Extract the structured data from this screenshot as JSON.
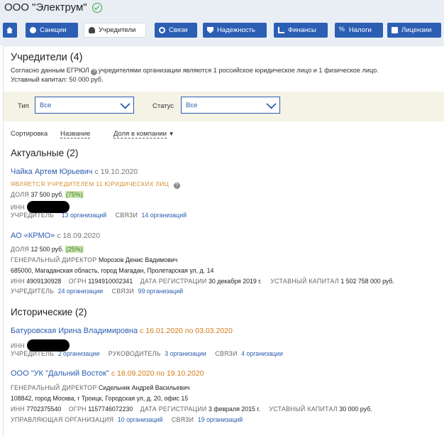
{
  "company": {
    "title": "ООО \"Электрум\""
  },
  "tabs": [
    {
      "label": "",
      "icon": "home-icon"
    },
    {
      "label": "Санкции",
      "icon": "globe-icon"
    },
    {
      "label": "Учредители",
      "icon": "users-icon"
    },
    {
      "label": "Связи",
      "icon": "link-icon"
    },
    {
      "label": "Надежность",
      "icon": "shield-icon"
    },
    {
      "label": "Финансы",
      "icon": "chart-icon"
    },
    {
      "label": "Налоги",
      "icon": "percent-icon"
    },
    {
      "label": "Лицензии",
      "icon": "document-icon"
    }
  ],
  "founders": {
    "heading": "Учредители (4)",
    "intro_before": "Согласно данным ЕГРЮЛ",
    "intro_after": "учредителями организации являются 1 российское юридическое лицо и 1 физическое лицо.",
    "capital": "Уставный капитал: 50 000 руб."
  },
  "filters": {
    "type_label": "Тип",
    "type_value": "Все",
    "status_label": "Статус",
    "status_value": "Все"
  },
  "sort": {
    "label": "Сортировка",
    "opt1": "Название",
    "opt2": "Доля в компании"
  },
  "current": {
    "heading": "Актуальные (2)",
    "p1": {
      "name": "Чайка Артем Юрьевич",
      "since": "с 19.10.2020",
      "warning": "ЯВЛЯЕТСЯ УЧРЕДИТЕЛЕМ 11 ЮРИДИЧЕСКИХ ЛИЦ",
      "share_label": "ДОЛЯ",
      "share_value": "37 500 руб.",
      "share_pct": "(75%)",
      "inn_label": "ИНН",
      "founder_label": "УЧРЕДИТЕЛЬ",
      "founder_link": "13 организаций",
      "links_label": "СВЯЗИ",
      "links_link": "14 организаций"
    },
    "p2": {
      "name": "АО «КРМО»",
      "since": "с 18.09.2020",
      "share_label": "ДОЛЯ",
      "share_value": "12 500 руб.",
      "share_pct": "(25%)",
      "director_label": "ГЕНЕРАЛЬНЫЙ ДИРЕКТОР",
      "director_name": "Морозов Денис Вадимович",
      "address": "685000, Магаданская область, город Магадан, Пролетарская ул, д. 14",
      "inn_label": "ИНН",
      "inn": "4909130928",
      "ogrn_label": "ОГРН",
      "ogrn": "1194910002341",
      "reg_label": "ДАТА РЕГИСТРАЦИИ",
      "reg": "30 декабря 2019 г.",
      "cap_label": "УСТАВНЫЙ КАПИТАЛ",
      "cap": "1 502 758 000 руб.",
      "founder_label": "УЧРЕДИТЕЛЬ",
      "founder_link": "24 организации",
      "links_label": "СВЯЗИ",
      "links_link": "99 организаций"
    }
  },
  "historical": {
    "heading": "Исторические (2)",
    "p1": {
      "name": "Батуровская Ирина Владимировна",
      "range": "с 16.01.2020 по 03.03.2020",
      "inn_label": "ИНН",
      "founder_label": "УЧРЕДИТЕЛЬ",
      "founder_link": "2 организации",
      "head_label": "РУКОВОДИТЕЛЬ",
      "head_link": "3 организации",
      "links_label": "СВЯЗИ",
      "links_link": "4 организации"
    },
    "p2": {
      "name": "ООО \"УК \"Дальний Восток\"",
      "range": "с 18.09.2020 по 19.10.2020",
      "director_label": "ГЕНЕРАЛЬНЫЙ ДИРЕКТОР",
      "director_name": "Сидельник Андрей Васильевич",
      "address": "108842, город Москва, г Троицк, Городская ул, д. 20, офис 15",
      "inn_label": "ИНН",
      "inn": "7702375540",
      "ogrn_label": "ОГРН",
      "ogrn": "1157746072230",
      "reg_label": "ДАТА РЕГИСТРАЦИИ",
      "reg": "3 февраля 2015 г.",
      "cap_label": "УСТАВНЫЙ КАПИТАЛ",
      "cap": "30 000 руб.",
      "mgmt_label": "УПРАВЛЯЮЩАЯ ОРГАНИЗАЦИЯ",
      "mgmt_link": "10 организаций",
      "links_label": "СВЯЗИ",
      "links_link": "19 организаций"
    }
  }
}
